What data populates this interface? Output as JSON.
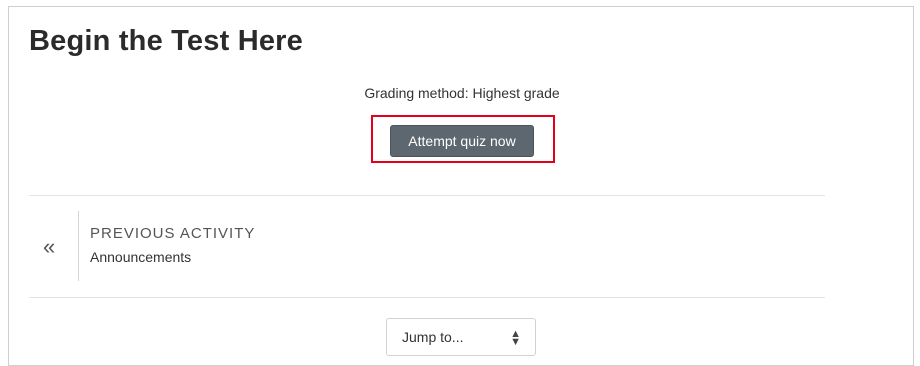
{
  "page": {
    "title": "Begin the Test Here",
    "grading_method": "Grading method: Highest grade"
  },
  "quiz": {
    "attempt_label": "Attempt quiz now",
    "highlight_color": "#e2001a",
    "button_color": "#5c6770"
  },
  "navigation": {
    "previous_heading": "PREVIOUS ACTIVITY",
    "previous_name": "Announcements",
    "previous_icon": "double-chevron-left-icon"
  },
  "jump": {
    "selected_label": "Jump to...",
    "arrow_icon": "up-down-arrows-icon"
  }
}
